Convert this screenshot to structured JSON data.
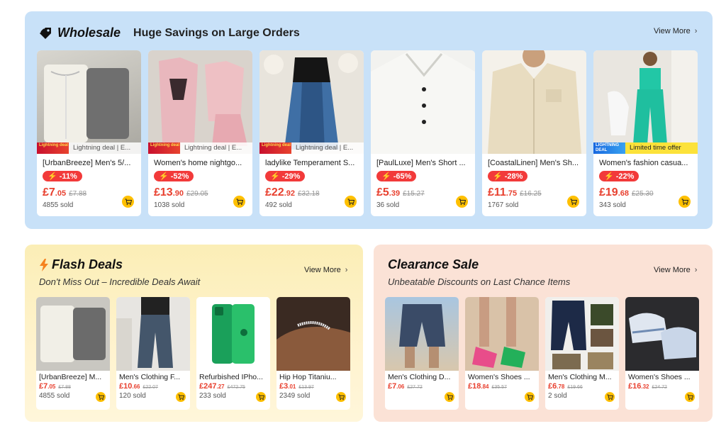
{
  "view_more": "View More",
  "wholesale": {
    "title": "Wholesale",
    "subtitle": "Huge Savings on Large Orders",
    "products": [
      {
        "title": "[UrbanBreeze] Men's 5/...",
        "discount": "-11%",
        "price_int": "£7",
        "price_dec": ".05",
        "old_price": "£7.88",
        "sold": "4855 sold",
        "deal_badge": "Lightning deal",
        "deal_text": "Lightning deal | E..."
      },
      {
        "title": "Women's home nightgo...",
        "discount": "-52%",
        "price_int": "£13",
        "price_dec": ".90",
        "old_price": "£29.05",
        "sold": "1038 sold",
        "deal_badge": "Lightning deal",
        "deal_text": "Lightning deal | E..."
      },
      {
        "title": "ladylike Temperament S...",
        "discount": "-29%",
        "price_int": "£22",
        "price_dec": ".92",
        "old_price": "£32.18",
        "sold": "492 sold",
        "deal_badge": "Lightning deal",
        "deal_text": "Lightning deal | E..."
      },
      {
        "title": "[PaulLuxe] Men's Short ...",
        "discount": "-65%",
        "price_int": "£5",
        "price_dec": ".39",
        "old_price": "£15.27",
        "sold": "36 sold"
      },
      {
        "title": "[CoastalLinen] Men's Sh...",
        "discount": "-28%",
        "price_int": "£11",
        "price_dec": ".75",
        "old_price": "£16.25",
        "sold": "1767 sold"
      },
      {
        "title": "Women's fashion casua...",
        "discount": "-22%",
        "price_int": "£19",
        "price_dec": ".68",
        "old_price": "£25.30",
        "sold": "343 sold",
        "deal_badge": "LIGHTNING DEAL",
        "deal_text": "Limited time offer"
      }
    ]
  },
  "flash": {
    "title": "Flash Deals",
    "subtitle": "Don't Miss Out – Incredible Deals Await",
    "products": [
      {
        "title": "[UrbanBreeze] M...",
        "price_int": "£7",
        "price_dec": ".05",
        "old_price": "£7.88",
        "sold": "4855 sold"
      },
      {
        "title": "Men's Clothing F...",
        "price_int": "£10",
        "price_dec": ".66",
        "old_price": "£22.07",
        "sold": "120 sold"
      },
      {
        "title": "Refurbished IPho...",
        "price_int": "£247",
        "price_dec": ".27",
        "old_price": "£472.75",
        "sold": "233 sold"
      },
      {
        "title": "Hip Hop Titaniu...",
        "price_int": "£3",
        "price_dec": ".01",
        "old_price": "£13.97",
        "sold": "2349 sold"
      }
    ]
  },
  "clearance": {
    "title": "Clearance Sale",
    "subtitle": "Unbeatable Discounts on Last Chance Items",
    "products": [
      {
        "title": "Men's Clothing D...",
        "price_int": "£7",
        "price_dec": ".06",
        "old_price": "£27.72",
        "sold": ""
      },
      {
        "title": "Women's Shoes ...",
        "price_int": "£18",
        "price_dec": ".84",
        "old_price": "£35.57",
        "sold": ""
      },
      {
        "title": "Men's Clothing M...",
        "price_int": "£6",
        "price_dec": ".78",
        "old_price": "£19.66",
        "sold": "2 sold"
      },
      {
        "title": "Women's Shoes ...",
        "price_int": "£16",
        "price_dec": ".32",
        "old_price": "£24.72",
        "sold": ""
      }
    ]
  },
  "colors": {
    "accent_price": "#e8402f",
    "discount_badge": "#f23a3a",
    "cart_button": "#ffc000",
    "wholesale_bg": "#c8e1f8",
    "flash_bg": "#fbeeb6",
    "clearance_bg": "#fbe2d6"
  }
}
